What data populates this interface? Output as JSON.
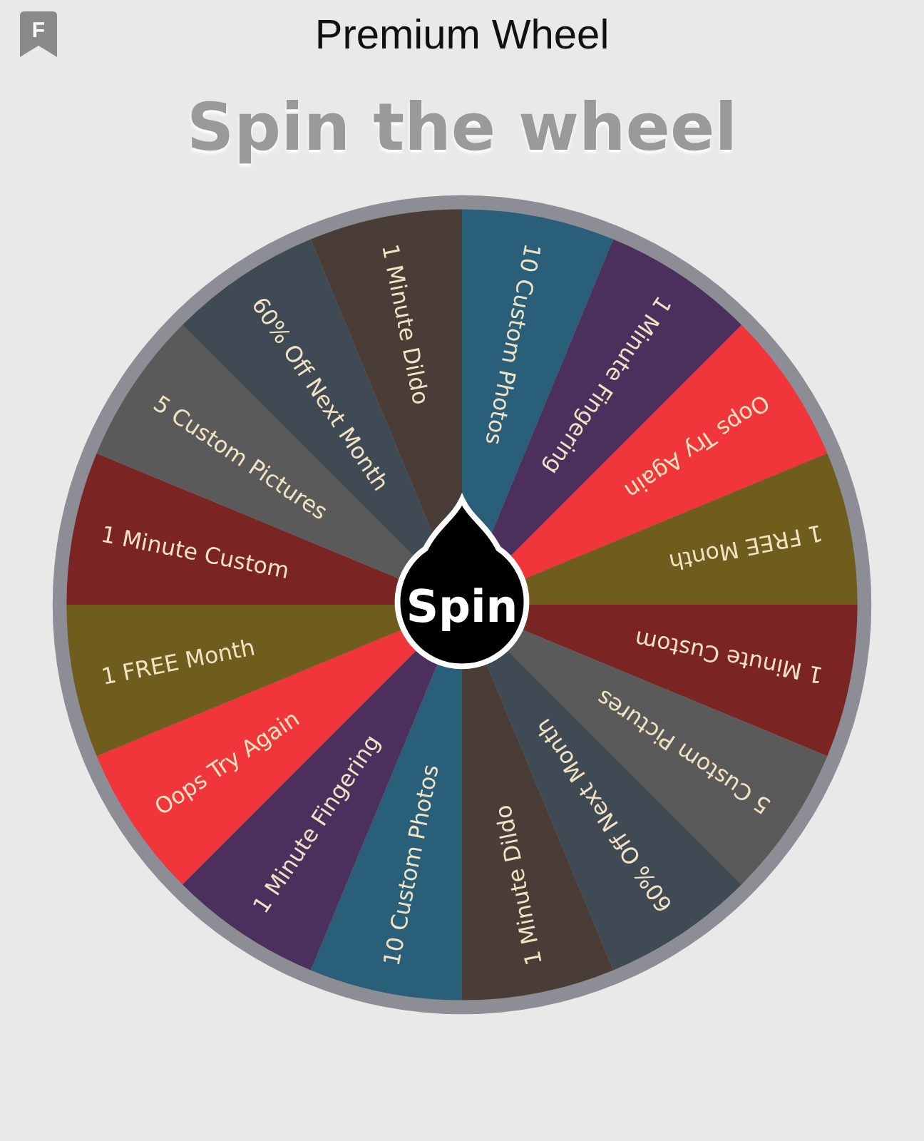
{
  "app_icon": {
    "letter": "F"
  },
  "window": {
    "title": "Premium Wheel"
  },
  "heading": "Spin the wheel",
  "wheel": {
    "segments": [
      {
        "label": "10 Custom Photos",
        "color": "#2a5f7a"
      },
      {
        "label": "1 Minute Fingering",
        "color": "#4b2f5c"
      },
      {
        "label": "Oops Try Again",
        "color": "#f0363a"
      },
      {
        "label": "1 FREE Month",
        "color": "#6e5d1c"
      },
      {
        "label": "1 Minute Custom",
        "color": "#7a2424"
      },
      {
        "label": "5 Custom Pictures",
        "color": "#5a5a5a"
      },
      {
        "label": "60% Off Next Month",
        "color": "#3f4a54"
      },
      {
        "label": "1 Minute Dildo",
        "color": "#4a3c36"
      },
      {
        "label": "10 Custom Photos",
        "color": "#2a5f7a"
      },
      {
        "label": "1 Minute Fingering",
        "color": "#4b2f5c"
      },
      {
        "label": "Oops Try Again",
        "color": "#f0363a"
      },
      {
        "label": "1 FREE Month",
        "color": "#6e5d1c"
      },
      {
        "label": "1 Minute Custom",
        "color": "#7a2424"
      },
      {
        "label": "5 Custom Pictures",
        "color": "#5a5a5a"
      },
      {
        "label": "60% Off Next Month",
        "color": "#3f4a54"
      },
      {
        "label": "1 Minute Dildo",
        "color": "#4a3c36"
      }
    ],
    "spin_button": "Spin"
  }
}
